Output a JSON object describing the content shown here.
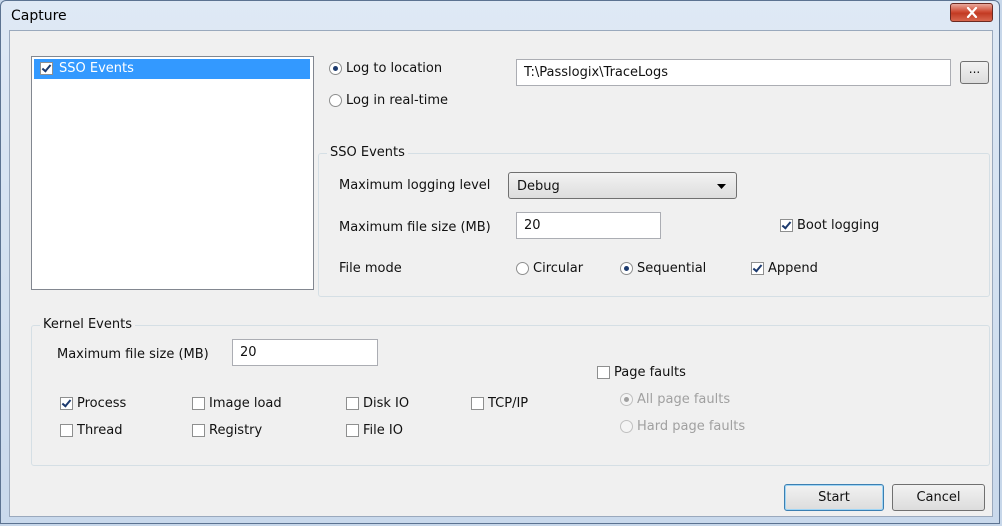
{
  "window": {
    "title": "Capture"
  },
  "event_list": {
    "items": [
      {
        "label": "SSO Events",
        "checked": true,
        "selected": true
      }
    ]
  },
  "log_mode": {
    "to_location_label": "Log to location",
    "to_location_selected": true,
    "realtime_label": "Log in real-time",
    "realtime_selected": false,
    "location_value": "T:\\Passlogix\\TraceLogs",
    "browse_label": "..."
  },
  "sso_events": {
    "group_title": "SSO Events",
    "max_level_label": "Maximum logging level",
    "max_level_value": "Debug",
    "max_size_label": "Maximum file size (MB)",
    "max_size_value": "20",
    "boot_logging_label": "Boot logging",
    "boot_logging_checked": true,
    "file_mode_label": "File mode",
    "circular_label": "Circular",
    "circular_selected": false,
    "sequential_label": "Sequential",
    "sequential_selected": true,
    "append_label": "Append",
    "append_checked": true
  },
  "kernel_events": {
    "group_title": "Kernel Events",
    "max_size_label": "Maximum file size (MB)",
    "max_size_value": "20",
    "process_label": "Process",
    "process_checked": true,
    "thread_label": "Thread",
    "thread_checked": false,
    "image_load_label": "Image load",
    "image_load_checked": false,
    "registry_label": "Registry",
    "registry_checked": false,
    "disk_io_label": "Disk IO",
    "disk_io_checked": false,
    "file_io_label": "File IO",
    "file_io_checked": false,
    "tcpip_label": "TCP/IP",
    "tcpip_checked": false,
    "page_faults_label": "Page faults",
    "page_faults_checked": false,
    "all_page_faults_label": "All page faults",
    "all_page_faults_selected": true,
    "hard_page_faults_label": "Hard page faults",
    "hard_page_faults_selected": false
  },
  "buttons": {
    "start_label": "Start",
    "cancel_label": "Cancel"
  },
  "colors": {
    "selection": "#3399ff",
    "title_bar": "#dfe9f5",
    "close_button": "#c23a23"
  },
  "icons": {
    "close": "close-icon",
    "dropdown": "chevron-down-icon"
  }
}
